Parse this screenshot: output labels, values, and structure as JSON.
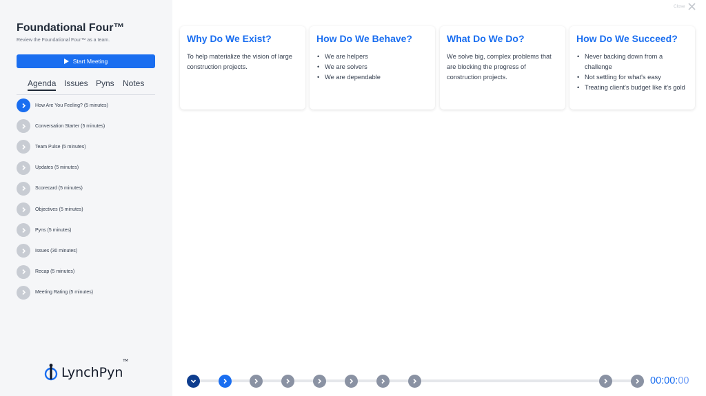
{
  "sidebar": {
    "title": "Foundational Four™",
    "subtitle": "Review the Foundational Four™ as a team.",
    "start_button": "Start Meeting",
    "tabs": [
      "Agenda",
      "Issues",
      "Pyns",
      "Notes"
    ],
    "active_tab": "Agenda",
    "agenda": [
      "How Are You Feeling? (5 minutes)",
      "Conversation Starter (5 minutes)",
      "Team Pulse (5 minutes)",
      "Updates (5 minutes)",
      "Scorecard (5 minutes)",
      "Objectives (5 minutes)",
      "Pyns (5 minutes)",
      "Issues (30 minutes)",
      "Recap (5 minutes)",
      "Meeting Rating (5 minutes)"
    ],
    "active_agenda_index": 0,
    "logo_text": "LynchPyn",
    "logo_tm": "TM"
  },
  "close_label": "Close",
  "cards": [
    {
      "title": "Why Do We Exist?",
      "text": "To help materialize the vision of large construction projects."
    },
    {
      "title": "How Do We Behave?",
      "items": [
        "We are helpers",
        "We are solvers",
        "We are dependable"
      ]
    },
    {
      "title": "What Do We Do?",
      "text": "We solve big, complex problems that are blocking the progress of construction projects."
    },
    {
      "title": "How Do We Succeed?",
      "items": [
        "Never backing down from a challenge",
        "Not settling for what's easy",
        "Treating client's budget like it's gold"
      ]
    }
  ],
  "timer": {
    "hm": "00:00:",
    "sec": "00"
  },
  "colors": {
    "accent": "#1a6ef0",
    "dark_accent": "#0e3d8e",
    "inactive": "#c8ccd3"
  }
}
